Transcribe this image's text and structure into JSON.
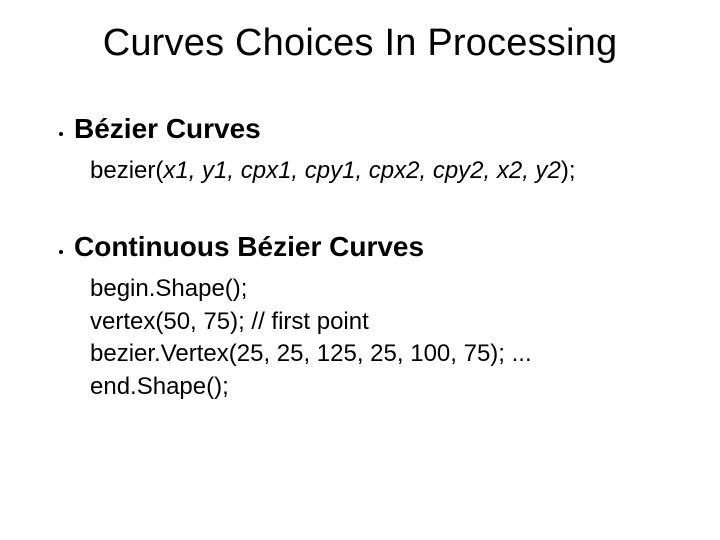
{
  "title": "Curves Choices In Processing",
  "sections": [
    {
      "heading": "Bézier Curves",
      "code": [
        {
          "prefix": "bezier(",
          "params": "x1, y1, cpx1, cpy1, cpx2, cpy2, x2, y2",
          "suffix": ");"
        }
      ]
    },
    {
      "heading": "Continuous Bézier Curves",
      "code": [
        {
          "text": "begin.Shape();"
        },
        {
          "text": "vertex(50, 75); // first point"
        },
        {
          "text": "bezier.Vertex(25, 25, 125, 25, 100, 75); ..."
        },
        {
          "text": "end.Shape();"
        }
      ]
    }
  ]
}
